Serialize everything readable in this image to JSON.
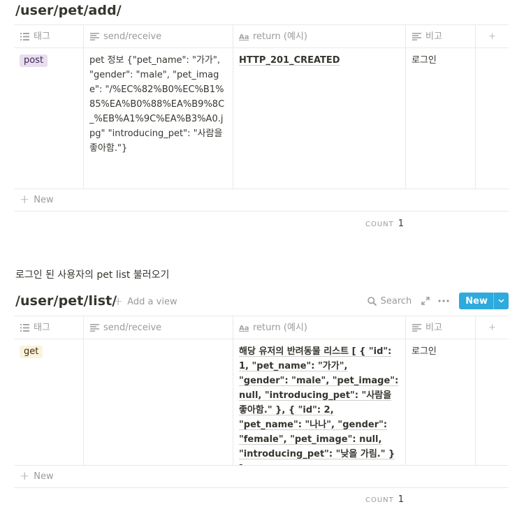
{
  "db1": {
    "title": "/user/pet/add/",
    "columns": [
      {
        "label": "태그",
        "icon": "list-icon"
      },
      {
        "label": "send/receive",
        "icon": "text-icon"
      },
      {
        "label": "return (예시)",
        "icon": "title-icon"
      },
      {
        "label": "비고",
        "icon": "text-icon"
      }
    ],
    "row": {
      "tag": "post",
      "send_receive": "pet 정보 {\"pet_name\": \"가가\", \"gender\": \"male\", \"pet_image\": \"/%EC%82%B0%EC%B1%85%EA%B0%88%EA%B9%8C_%EB%A1%9C%EA%B3%A0.jpg\" \"introducing_pet\": \"사람을 좋아함.\"}",
      "return": "HTTP_201_CREATED",
      "note": "로그인"
    },
    "new_label": "New",
    "count_label": "COUNT",
    "count_value": "1"
  },
  "section_heading": "로그인 된 사용자의 pet list 불러오기",
  "db2": {
    "title": "/user/pet/list/",
    "add_view_label": "Add a view",
    "search_label": "Search",
    "new_button_label": "New",
    "columns": [
      {
        "label": "태그",
        "icon": "list-icon"
      },
      {
        "label": "send/receive",
        "icon": "text-icon"
      },
      {
        "label": "return (예시)",
        "icon": "title-icon"
      },
      {
        "label": "비고",
        "icon": "text-icon"
      }
    ],
    "row": {
      "tag": "get",
      "send_receive": "",
      "return": "해당 유저의 반려동물 리스트 [ { \"id\": 1, \"pet_name\": \"가가\", \"gender\": \"male\", \"pet_image\": null, \"introducing_pet\": \"사람을 좋아함.\" }, { \"id\": 2, \"pet_name\": \"나나\", \"gender\": \"female\", \"pet_image\": null, \"introducing_pet\": \"낮을 가림.\" } ]",
      "note": "로그인"
    },
    "new_label": "New",
    "count_label": "COUNT",
    "count_value": "1"
  }
}
